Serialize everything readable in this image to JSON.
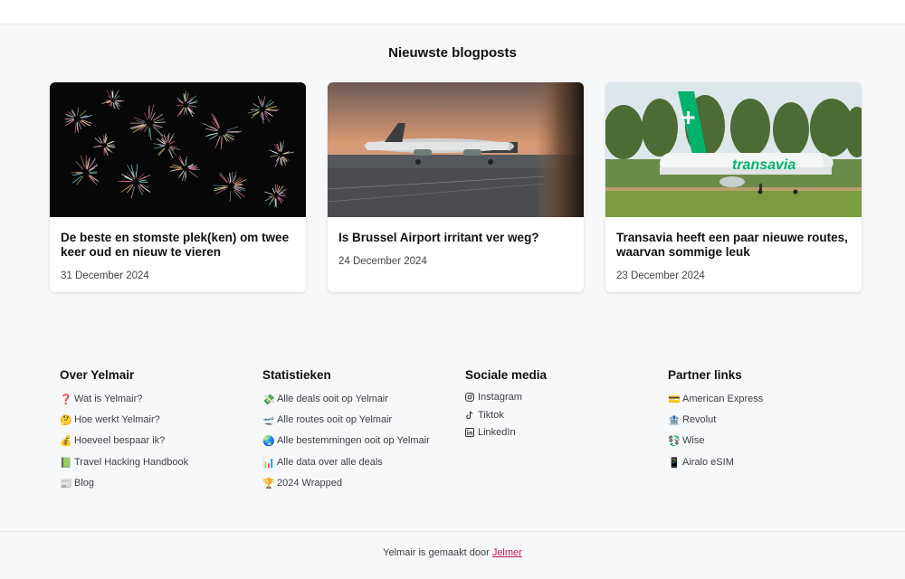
{
  "section_title": "Nieuwste blogposts",
  "posts": [
    {
      "title": "De beste en stomste plek(ken) om twee keer oud en nieuw te vieren",
      "date": "31 December 2024",
      "image": "fireworks-image"
    },
    {
      "title": "Is Brussel Airport irritant ver weg?",
      "date": "24 December 2024",
      "image": "airport-plane-image"
    },
    {
      "title": "Transavia heeft een paar nieuwe routes, waarvan sommige leuk",
      "date": "23 December 2024",
      "image": "transavia-plane-image"
    }
  ],
  "plane_livery_text": "transavia",
  "footer": {
    "about": {
      "title": "Over Yelmair",
      "items": [
        {
          "icon": "❓",
          "label": "Wat is Yelmair?"
        },
        {
          "icon": "🤔",
          "label": "Hoe werkt Yelmair?"
        },
        {
          "icon": "💰",
          "label": "Hoeveel bespaar ik?"
        },
        {
          "icon": "📗",
          "label": "Travel Hacking Handbook"
        },
        {
          "icon": "📰",
          "label": "Blog"
        }
      ]
    },
    "stats": {
      "title": "Statistieken",
      "items": [
        {
          "icon": "💸",
          "label": "Alle deals ooit op Yelmair"
        },
        {
          "icon": "🛫",
          "label": "Alle routes ooit op Yelmair"
        },
        {
          "icon": "🌏",
          "label": "Alle bestemmingen ooit op Yelmair"
        },
        {
          "icon": "📊",
          "label": "Alle data over alle deals"
        },
        {
          "icon": "🏆",
          "label": "2024 Wrapped"
        }
      ]
    },
    "social": {
      "title": "Sociale media",
      "items": [
        {
          "icon": "instagram-icon",
          "label": "Instagram"
        },
        {
          "icon": "tiktok-icon",
          "label": "Tiktok"
        },
        {
          "icon": "linkedin-icon",
          "label": "LinkedIn"
        }
      ]
    },
    "partners": {
      "title": "Partner links",
      "items": [
        {
          "icon": "💳",
          "label": "American Express"
        },
        {
          "icon": "🏦",
          "label": "Revolut"
        },
        {
          "icon": "💱",
          "label": "Wise"
        },
        {
          "icon": "📱",
          "label": "Airalo eSIM"
        }
      ]
    }
  },
  "bottom": {
    "text": "Yelmair is gemaakt door ",
    "link": "Jelmer"
  },
  "colors": {
    "accent_link": "#c2185b",
    "transavia_green": "#00b26b"
  }
}
